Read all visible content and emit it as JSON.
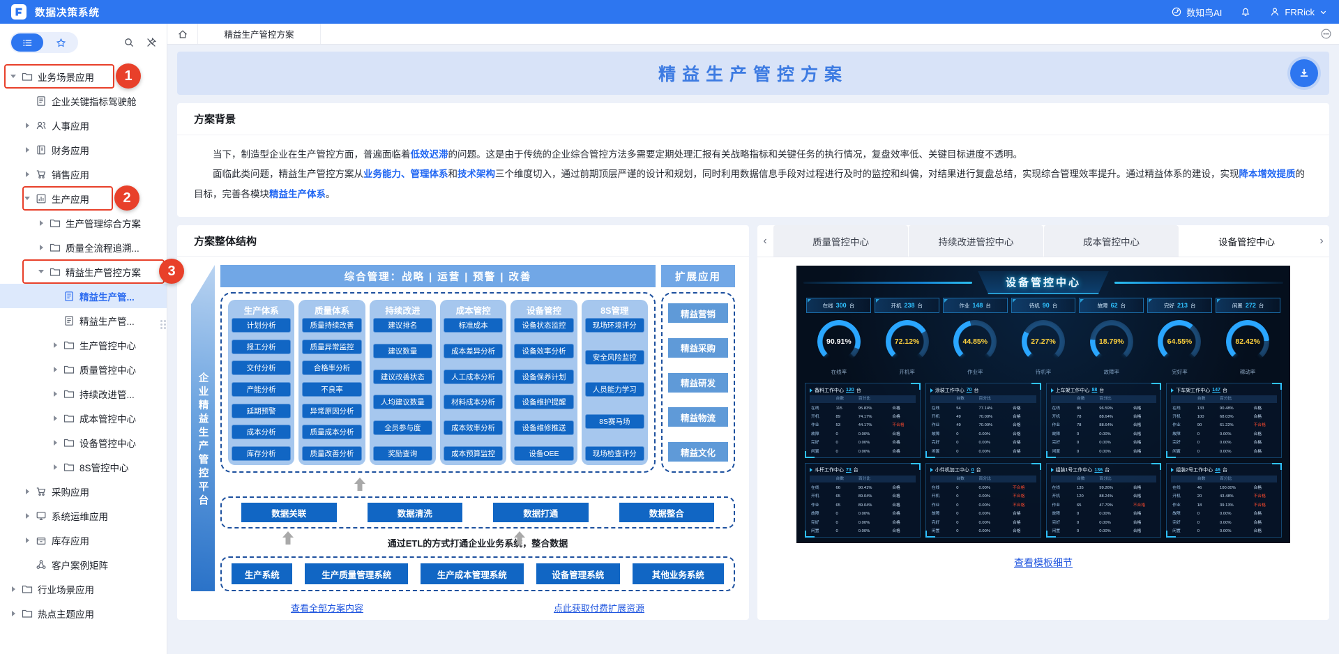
{
  "navbar": {
    "title": "数据决策系统",
    "ai_label": "数知鸟AI",
    "user_name": "FRRick"
  },
  "tabstrip": {
    "active_tab": "精益生产管控方案"
  },
  "sidebar": {
    "tree": [
      {
        "level": 0,
        "caret": "down",
        "icon": "folder",
        "label": "业务场景应用",
        "annotation": "1"
      },
      {
        "level": 1,
        "caret": "none",
        "icon": "doc",
        "label": "企业关键指标驾驶舱"
      },
      {
        "level": 1,
        "caret": "right",
        "icon": "users",
        "label": "人事应用"
      },
      {
        "level": 1,
        "caret": "right",
        "icon": "ledger",
        "label": "财务应用"
      },
      {
        "level": 1,
        "caret": "right",
        "icon": "cart",
        "label": "销售应用"
      },
      {
        "level": 1,
        "caret": "down",
        "icon": "chart",
        "label": "生产应用",
        "annotation": "2"
      },
      {
        "level": 2,
        "caret": "right",
        "icon": "folder",
        "label": "生产管理综合方案"
      },
      {
        "level": 2,
        "caret": "right",
        "icon": "folder",
        "label": "质量全流程追溯..."
      },
      {
        "level": 2,
        "caret": "down",
        "icon": "folder",
        "label": "精益生产管控方案",
        "annotation": "3"
      },
      {
        "level": 3,
        "caret": "none",
        "icon": "doc",
        "label": "精益生产管...",
        "selected": true
      },
      {
        "level": 3,
        "caret": "none",
        "icon": "doc",
        "label": "精益生产管..."
      },
      {
        "level": 3,
        "caret": "right",
        "icon": "folder",
        "label": "生产管控中心"
      },
      {
        "level": 3,
        "caret": "right",
        "icon": "folder",
        "label": "质量管控中心"
      },
      {
        "level": 3,
        "caret": "right",
        "icon": "folder",
        "label": "持续改进管..."
      },
      {
        "level": 3,
        "caret": "right",
        "icon": "folder",
        "label": "成本管控中心"
      },
      {
        "level": 3,
        "caret": "right",
        "icon": "folder",
        "label": "设备管控中心"
      },
      {
        "level": 3,
        "caret": "right",
        "icon": "folder",
        "label": "8S管控中心"
      },
      {
        "level": 1,
        "caret": "right",
        "icon": "cart",
        "label": "采购应用"
      },
      {
        "level": 1,
        "caret": "right",
        "icon": "monitor",
        "label": "系统运维应用"
      },
      {
        "level": 1,
        "caret": "right",
        "icon": "box",
        "label": "库存应用"
      },
      {
        "level": 1,
        "caret": "none",
        "icon": "org",
        "label": "客户案例矩阵"
      },
      {
        "level": 0,
        "caret": "right",
        "icon": "folder",
        "label": "行业场景应用"
      },
      {
        "level": 0,
        "caret": "right",
        "icon": "folder",
        "label": "热点主题应用"
      }
    ]
  },
  "page": {
    "title": "精益生产管控方案"
  },
  "background": {
    "heading": "方案背景",
    "p1": [
      {
        "t": "当下，制造型企业在生产管控方面，普遍面临着"
      },
      {
        "t": "低效迟滞",
        "kw": true
      },
      {
        "t": "的问题。这是由于传统的企业综合管控方法多需要定期处理汇报有关战略指标和关键任务的执行情况，复盘效率低、关键目标进度不透明。"
      }
    ],
    "p2": [
      {
        "t": "面临此类问题，精益生产管控方案从"
      },
      {
        "t": "业务能力、管理体系",
        "kw": true
      },
      {
        "t": "和"
      },
      {
        "t": "技术架构",
        "kw": true
      },
      {
        "t": "三个维度切入，通过前期顶层严谨的设计和规划，同时利用数据信息手段对过程进行及时的监控和纠偏，对结果进行复盘总结，实现综合管理效率提升。通过精益体系的建设，实现"
      },
      {
        "t": "降本增效提质",
        "kw": true
      },
      {
        "t": "的目标，完善各模块"
      },
      {
        "t": "精益生产体系",
        "kw": true
      },
      {
        "t": "。"
      }
    ]
  },
  "structure": {
    "heading": "方案整体结构",
    "platform_label": "企业精益生产管控平台",
    "top_bar": "综合管理：战略 | 运营 | 预警 | 改善",
    "ext_header": "扩展应用",
    "modules": [
      {
        "title": "生产体系",
        "items": [
          "计划分析",
          "报工分析",
          "交付分析",
          "产能分析",
          "延期预警",
          "成本分析",
          "库存分析"
        ]
      },
      {
        "title": "质量体系",
        "items": [
          "质量持续改善",
          "质量异常监控",
          "合格率分析",
          "不良率",
          "异常原因分析",
          "质量成本分析",
          "质量改善分析"
        ]
      },
      {
        "title": "持续改进",
        "items": [
          "建议排名",
          "建议数量",
          "建议改善状态",
          "人均建议数量",
          "全员参与度",
          "奖励查询"
        ]
      },
      {
        "title": "成本管控",
        "items": [
          "标准成本",
          "成本差异分析",
          "人工成本分析",
          "材料成本分析",
          "成本效率分析",
          "成本预算监控"
        ]
      },
      {
        "title": "设备管控",
        "items": [
          "设备状态监控",
          "设备效率分析",
          "设备保养计划",
          "设备维护提醒",
          "设备维修推送",
          "设备OEE"
        ]
      },
      {
        "title": "8S管理",
        "items": [
          "现场环境评分",
          "安全风险监控",
          "人员能力学习",
          "8S赛马场",
          "现场检查评分"
        ]
      }
    ],
    "extensions": [
      "精益营销",
      "精益采购",
      "精益研发",
      "精益物流",
      "精益文化"
    ],
    "data_layer": [
      "数据关联",
      "数据清洗",
      "数据打通",
      "数据整合"
    ],
    "etl_note": "通过ETL的方式打通企业业务系统，整合数据",
    "systems": [
      "生产系统",
      "生产质量管理系统",
      "生产成本管理系统",
      "设备管理系统",
      "其他业务系统"
    ],
    "links": [
      "查看全部方案内容",
      "点此获取付费扩展资源"
    ]
  },
  "templates": {
    "tabs": [
      "质量管控中心",
      "持续改进管控中心",
      "成本管控中心",
      "设备管控中心"
    ],
    "active_tab": "设备管控中心",
    "link": "查看模板细节",
    "dashboard": {
      "title": "设备管控中心",
      "unit": "台",
      "chips": [
        {
          "label": "在线",
          "value": 300
        },
        {
          "label": "开机",
          "value": 238
        },
        {
          "label": "作业",
          "value": 148
        },
        {
          "label": "待机",
          "value": 90
        },
        {
          "label": "故障",
          "value": 62
        },
        {
          "label": "完好",
          "value": 213
        },
        {
          "label": "闲置",
          "value": 272
        }
      ],
      "gauges": [
        {
          "label": "在线率",
          "value": 90.91
        },
        {
          "label": "开机率",
          "value": 72.12
        },
        {
          "label": "作业率",
          "value": 44.85
        },
        {
          "label": "待机率",
          "value": 27.27
        },
        {
          "label": "故障率",
          "value": 18.79
        },
        {
          "label": "完好率",
          "value": 64.55
        },
        {
          "label": "稼动率",
          "value": 82.42
        }
      ],
      "table_header": [
        "",
        "台数",
        "百分比",
        ""
      ],
      "row_labels": [
        "在线",
        "开机",
        "作业",
        "故障",
        "完好",
        "闲置"
      ],
      "workcenters": [
        {
          "name": "备料工作中心",
          "count": 120,
          "rows": [
            [
              115,
              "95.83%",
              "合格"
            ],
            [
              89,
              "74.17%",
              "合格"
            ],
            [
              53,
              "44.17%",
              "不合格"
            ],
            [
              0,
              "0.00%",
              "合格"
            ],
            [
              0,
              "0.00%",
              "合格"
            ],
            [
              0,
              "0.00%",
              "合格"
            ]
          ]
        },
        {
          "name": "涂装工作中心",
          "count": 70,
          "rows": [
            [
              54,
              "77.14%",
              "合格"
            ],
            [
              49,
              "70.00%",
              "合格"
            ],
            [
              49,
              "70.00%",
              "合格"
            ],
            [
              0,
              "0.00%",
              "合格"
            ],
            [
              0,
              "0.00%",
              "合格"
            ],
            [
              0,
              "0.00%",
              "合格"
            ]
          ]
        },
        {
          "name": "上车架工作中心",
          "count": 88,
          "rows": [
            [
              85,
              "96.59%",
              "合格"
            ],
            [
              78,
              "88.64%",
              "合格"
            ],
            [
              78,
              "88.64%",
              "合格"
            ],
            [
              0,
              "0.00%",
              "合格"
            ],
            [
              0,
              "0.00%",
              "合格"
            ],
            [
              0,
              "0.00%",
              "合格"
            ]
          ]
        },
        {
          "name": "下车架工作中心",
          "count": 147,
          "rows": [
            [
              133,
              "90.48%",
              "合格"
            ],
            [
              100,
              "68.03%",
              "合格"
            ],
            [
              90,
              "61.22%",
              "不合格"
            ],
            [
              0,
              "0.00%",
              "合格"
            ],
            [
              0,
              "0.00%",
              "合格"
            ],
            [
              0,
              "0.00%",
              "合格"
            ]
          ]
        },
        {
          "name": "斗杆工作中心",
          "count": 73,
          "rows": [
            [
              66,
              "90.41%",
              "合格"
            ],
            [
              65,
              "89.04%",
              "合格"
            ],
            [
              65,
              "89.04%",
              "合格"
            ],
            [
              0,
              "0.00%",
              "合格"
            ],
            [
              0,
              "0.00%",
              "合格"
            ],
            [
              0,
              "0.00%",
              "合格"
            ]
          ]
        },
        {
          "name": "小件机加工中心",
          "count": 0,
          "rows": [
            [
              0,
              "0.00%",
              "不合格"
            ],
            [
              0,
              "0.00%",
              "不合格"
            ],
            [
              0,
              "0.00%",
              "不合格"
            ],
            [
              0,
              "0.00%",
              "合格"
            ],
            [
              0,
              "0.00%",
              "合格"
            ],
            [
              0,
              "0.00%",
              "合格"
            ]
          ]
        },
        {
          "name": "组装1号工作中心",
          "count": 136,
          "rows": [
            [
              135,
              "99.26%",
              "合格"
            ],
            [
              120,
              "88.24%",
              "合格"
            ],
            [
              65,
              "47.79%",
              "不合格"
            ],
            [
              0,
              "0.00%",
              "合格"
            ],
            [
              0,
              "0.00%",
              "合格"
            ],
            [
              0,
              "0.00%",
              "合格"
            ]
          ]
        },
        {
          "name": "组装2号工作中心",
          "count": 46,
          "rows": [
            [
              46,
              "100.00%",
              "合格"
            ],
            [
              20,
              "43.48%",
              "不合格"
            ],
            [
              18,
              "39.13%",
              "不合格"
            ],
            [
              0,
              "0.00%",
              "合格"
            ],
            [
              0,
              "0.00%",
              "合格"
            ],
            [
              0,
              "0.00%",
              "合格"
            ]
          ]
        }
      ]
    }
  },
  "annotations": {
    "badges": [
      "1",
      "2",
      "3"
    ]
  }
}
